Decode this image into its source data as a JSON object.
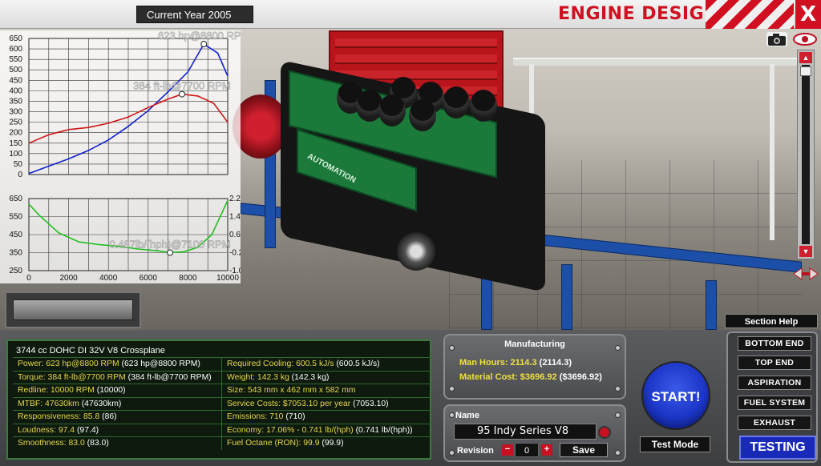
{
  "header": {
    "year_label": "Current Year 2005",
    "title": "ENGINE DESIGN",
    "close": "X"
  },
  "icons": {
    "camera": "camera-icon",
    "eye": "eye-icon",
    "scroll_up": "▲",
    "scroll_down": "▼"
  },
  "chart_data": [
    {
      "type": "line",
      "xlim": [
        0,
        10000
      ],
      "ylim": [
        0,
        650
      ],
      "yticks": [
        "650",
        "600",
        "550",
        "500",
        "450",
        "400",
        "350",
        "300",
        "250",
        "200",
        "150",
        "100",
        "50",
        "0"
      ],
      "series": [
        {
          "color": "#1020d0",
          "x": [
            0,
            1000,
            2000,
            3000,
            4000,
            5000,
            6000,
            7000,
            8000,
            8800,
            9500,
            10000
          ],
          "y": [
            5,
            40,
            75,
            115,
            165,
            230,
            305,
            395,
            490,
            623,
            580,
            470
          ]
        },
        {
          "color": "#d01818",
          "x": [
            0,
            1000,
            2000,
            3000,
            4000,
            5000,
            6000,
            7000,
            7700,
            8500,
            9300,
            10000
          ],
          "y": [
            150,
            190,
            215,
            225,
            245,
            275,
            320,
            360,
            384,
            375,
            340,
            250
          ]
        }
      ],
      "annotations": [
        {
          "text": "623 hp@8800 RPM",
          "x": 8800,
          "y": 623
        },
        {
          "text": "384 ft-lb@7700 RPM",
          "x": 7700,
          "y": 384
        }
      ]
    },
    {
      "type": "line",
      "xlim": [
        0,
        10000
      ],
      "ylim": [
        250,
        650
      ],
      "xticks": [
        "0",
        "2000",
        "4000",
        "6000",
        "8000",
        "10000"
      ],
      "yticks_left": [
        "650",
        "550",
        "450",
        "350",
        "250"
      ],
      "yticks_right": [
        "2.2",
        "1.4",
        "0.6",
        "-0.2",
        "-1.0"
      ],
      "series": [
        {
          "color": "#20c020",
          "x": [
            0,
            500,
            1500,
            2500,
            3500,
            4500,
            5500,
            6500,
            7100,
            7800,
            8500,
            9200,
            10000
          ],
          "y": [
            620,
            560,
            460,
            410,
            395,
            385,
            370,
            360,
            350,
            355,
            380,
            450,
            640
          ]
        }
      ],
      "annotations": [
        {
          "text": "0.487lb/(hph)@7100 RPM",
          "x": 7100,
          "y": 350
        }
      ]
    }
  ],
  "stats": {
    "header": "3744 cc DOHC DI 32V V8 Crossplane",
    "rows": [
      {
        "left_label": "Power: 623 hp@8800 RPM",
        "left_paren": " (623 hp@8800 RPM)",
        "right_label": "Required Cooling: 600.5 kJ/s",
        "right_paren": " (600.5 kJ/s)"
      },
      {
        "left_label": "Torque: 384 ft-lb@7700 RPM",
        "left_paren": " (384 ft-lb@7700 RPM)",
        "right_label": "Weight: 142.3 kg",
        "right_paren": " (142.3 kg)"
      },
      {
        "left_label": "Redline: 10000 RPM",
        "left_paren": " (10000)",
        "right_label": "Size: 543 mm x 462 mm x 582 mm",
        "right_paren": ""
      },
      {
        "left_label": "MTBF: 47630km",
        "left_paren": " (47630km)",
        "right_label": "Service Costs: $7053.10 per year",
        "right_paren": " (7053.10)"
      },
      {
        "left_label": "Responsiveness: 85.8",
        "left_paren": " (86)",
        "right_label": "Emissions: 710",
        "right_paren": " (710)"
      },
      {
        "left_label": "Loudness: 97.4",
        "left_paren": " (97.4)",
        "right_label": "Economy: 17.06% - 0.741 lb/(hph)",
        "right_paren": " (0.741 lb/(hph))"
      },
      {
        "left_label": "Smoothness: 83.0",
        "left_paren": " (83.0)",
        "right_label": "Fuel Octane (RON): 99.9",
        "right_paren": " (99.9)"
      }
    ]
  },
  "manufacturing": {
    "title": "Manufacturing",
    "man_hours_label": "Man Hours: 2114.3",
    "man_hours_paren": " (2114.3)",
    "material_label": "Material Cost: $3696.92",
    "material_paren": " ($3696.92)"
  },
  "name_panel": {
    "name_label": "Name",
    "name_value": "95 Indy Series V8",
    "revision_label": "Revision",
    "revision_value": "0",
    "minus": "−",
    "plus": "+",
    "save_label": "Save"
  },
  "actions": {
    "start": "START!",
    "test_mode": "Test Mode",
    "section_help": "Section Help"
  },
  "sections": {
    "items": [
      "BOTTOM END",
      "TOP END",
      "ASPIRATION",
      "FUEL SYSTEM",
      "EXHAUST"
    ],
    "active": "TESTING"
  }
}
